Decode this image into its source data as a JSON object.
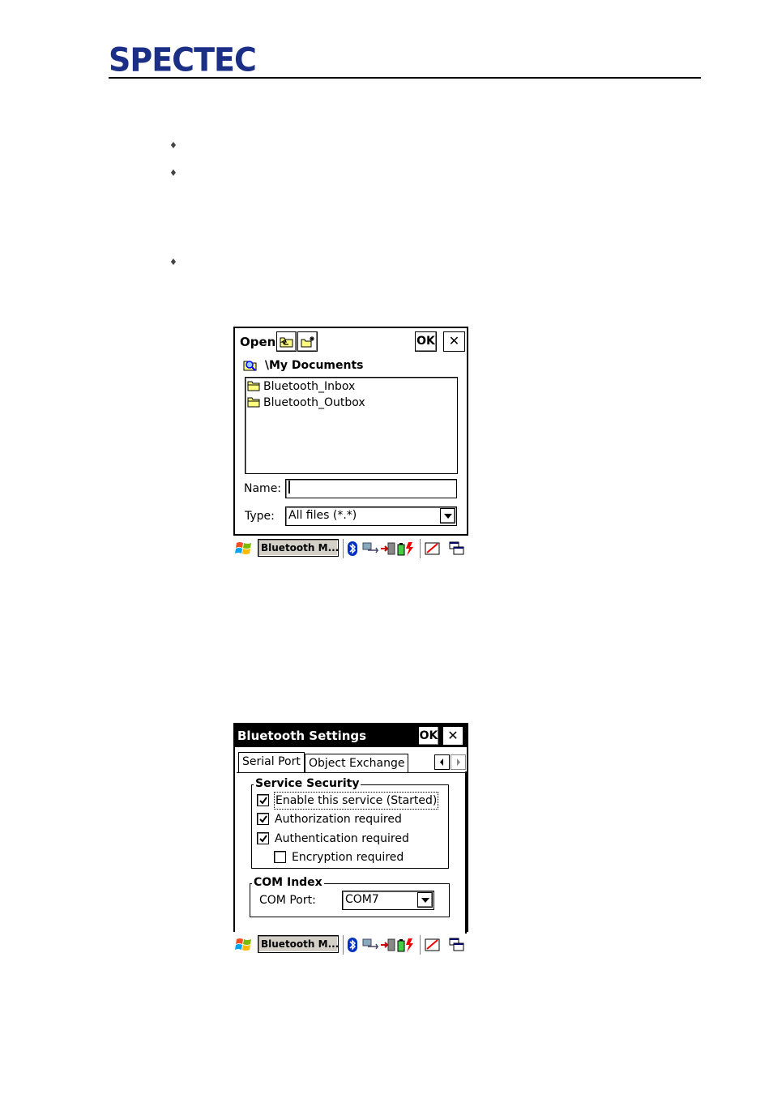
{
  "header": {
    "logo_text": "SPECTEC"
  },
  "open_dialog": {
    "title": "Open",
    "ok_label": "OK",
    "close_label": "✕",
    "path": "\\My Documents",
    "items": [
      {
        "label": "Bluetooth_Inbox"
      },
      {
        "label": "Bluetooth_Outbox"
      }
    ],
    "name_label": "Name:",
    "name_value": "",
    "type_label": "Type:",
    "type_value": "All files (*.*)"
  },
  "taskbar": {
    "task_label": "Bluetooth M..."
  },
  "bt_settings": {
    "title": "Bluetooth Settings",
    "ok_label": "OK",
    "close_label": "✕",
    "tabs": [
      {
        "label": "Serial Port",
        "active": true
      },
      {
        "label": "Object Exchange",
        "active": false
      }
    ],
    "service_security": {
      "legend": "Service Security",
      "options": [
        {
          "label": "Enable this service (Started)",
          "checked": true
        },
        {
          "label": "Authorization required",
          "checked": true
        },
        {
          "label": "Authentication required",
          "checked": true
        },
        {
          "label": "Encryption required",
          "checked": false
        }
      ]
    },
    "com_index": {
      "legend": "COM Index",
      "port_label": "COM Port:",
      "port_value": "COM7"
    }
  },
  "colors": {
    "logo_blue": "#1c2f86",
    "title_bar": "#000000",
    "task_button": "#d4d0c8"
  }
}
